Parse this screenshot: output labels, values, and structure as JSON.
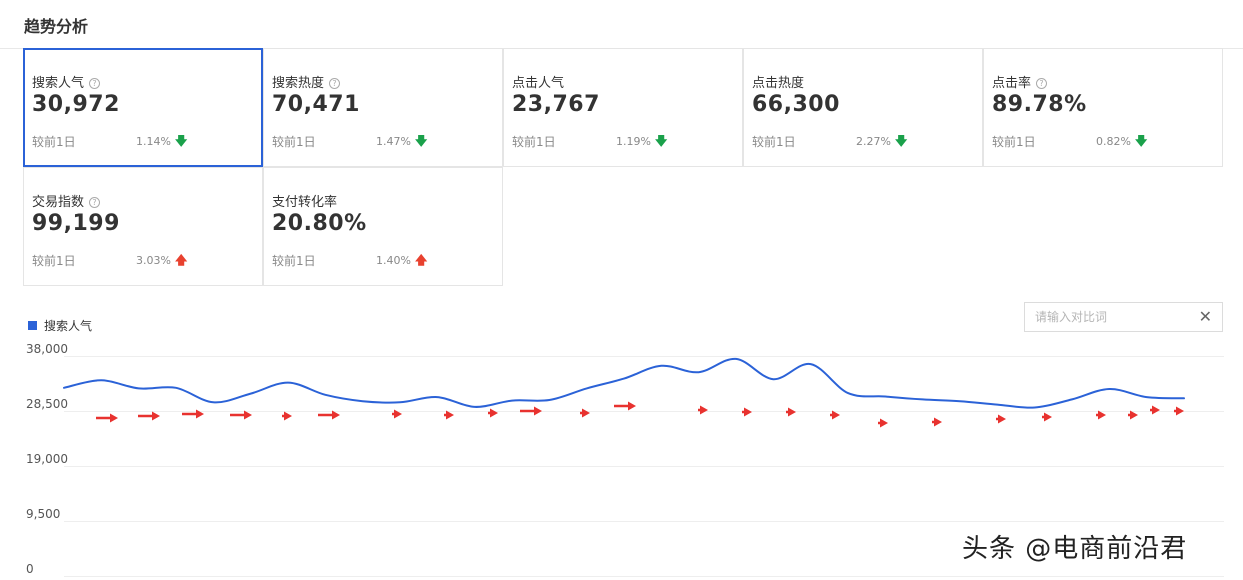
{
  "header": {
    "title": "趋势分析"
  },
  "cards": [
    {
      "label": "搜索人气",
      "help": true,
      "value": "30,972",
      "compare": "较前1日",
      "pct": "1.14%",
      "trend": "down",
      "active": true
    },
    {
      "label": "搜索热度",
      "help": true,
      "value": "70,471",
      "compare": "较前1日",
      "pct": "1.47%",
      "trend": "down",
      "active": false
    },
    {
      "label": "点击人气",
      "help": false,
      "value": "23,767",
      "compare": "较前1日",
      "pct": "1.19%",
      "trend": "down",
      "active": false
    },
    {
      "label": "点击热度",
      "help": false,
      "value": "66,300",
      "compare": "较前1日",
      "pct": "2.27%",
      "trend": "down",
      "active": false
    },
    {
      "label": "点击率",
      "help": true,
      "value": "89.78%",
      "compare": "较前1日",
      "pct": "0.82%",
      "trend": "down",
      "active": false
    },
    {
      "label": "交易指数",
      "help": true,
      "value": "99,199",
      "compare": "较前1日",
      "pct": "3.03%",
      "trend": "up",
      "active": false
    },
    {
      "label": "支付转化率",
      "help": false,
      "value": "20.80%",
      "compare": "较前1日",
      "pct": "1.40%",
      "trend": "up",
      "active": false
    }
  ],
  "help_icon": "?",
  "arrows": {
    "down": "🡇",
    "up": "🡅"
  },
  "colors": {
    "accent": "#2b62d7",
    "down": "#1aa14b",
    "up": "#e8412f",
    "annotation": "#e8322f"
  },
  "compare_input": {
    "placeholder": "请输入对比词",
    "value": "",
    "clear_icon": "✕"
  },
  "chart_data": {
    "type": "line",
    "series": [
      {
        "name": "搜索人气",
        "values": [
          32500,
          33800,
          32400,
          32500,
          30000,
          31500,
          33400,
          31300,
          30200,
          30000,
          30900,
          29200,
          30300,
          30400,
          32400,
          34100,
          36300,
          35200,
          37500,
          34000,
          36600,
          31600,
          31000,
          30500,
          30200,
          29600,
          29100,
          30500,
          32300,
          30900,
          30700
        ]
      }
    ],
    "yticks": [
      "38,000",
      "28,500",
      "19,000",
      "9,500",
      "0"
    ],
    "ylim": [
      0,
      38000
    ],
    "grid": true,
    "legend": "top-left"
  },
  "watermark": "头条 @电商前沿君"
}
